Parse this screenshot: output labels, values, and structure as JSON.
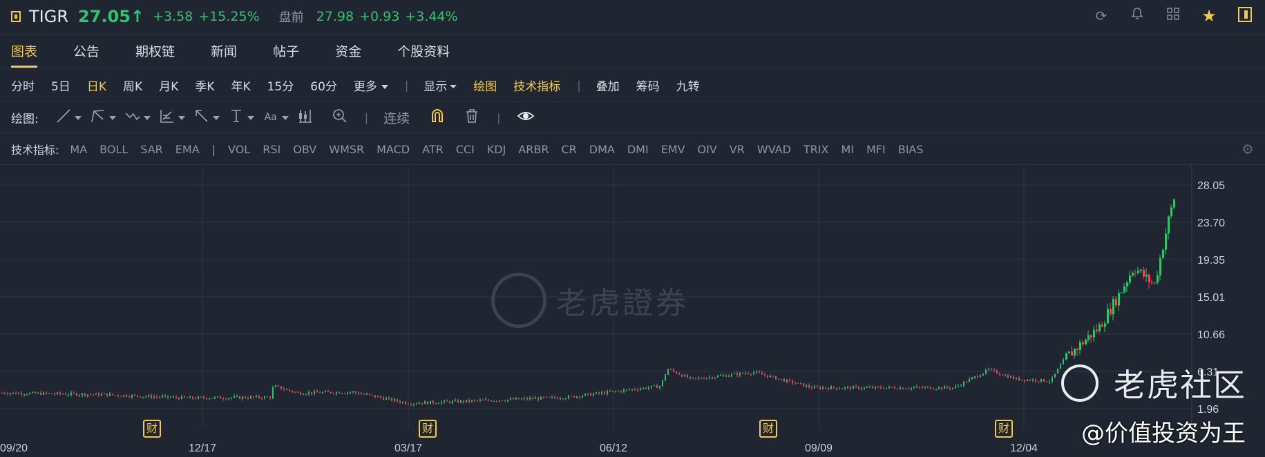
{
  "header": {
    "symbol": "TIGR",
    "price": "27.05↑",
    "change": "+3.58",
    "change_pct": "+15.25%",
    "premarket_label": "盘前",
    "premarket_price": "27.98",
    "premarket_change": "+0.93",
    "premarket_change_pct": "+3.44%"
  },
  "tabs": [
    "图表",
    "公告",
    "期权链",
    "新闻",
    "帖子",
    "资金",
    "个股资料"
  ],
  "periods": {
    "items": [
      "分时",
      "5日",
      "日K",
      "周K",
      "月K",
      "季K",
      "年K",
      "15分",
      "60分"
    ],
    "more": "更多",
    "display": "显示",
    "draw": "绘图",
    "indicators": "技术指标",
    "overlay": "叠加",
    "chips": "筹码",
    "nine": "九转"
  },
  "tools": {
    "label": "绘图:",
    "continuous": "连续"
  },
  "indicators": {
    "label": "技术指标:",
    "main": [
      "MA",
      "BOLL",
      "SAR",
      "EMA"
    ],
    "sub": [
      "VOL",
      "RSI",
      "OBV",
      "WMSR",
      "MACD",
      "ATR",
      "CCI",
      "KDJ",
      "ARBR",
      "CR",
      "DMA",
      "DMI",
      "EMV",
      "OIV",
      "VR",
      "WVAD",
      "TRIX",
      "MI",
      "MFI",
      "BIAS"
    ]
  },
  "chart": {
    "y_ticks": [
      "28.05",
      "23.70",
      "19.35",
      "15.01",
      "10.66",
      "6.31",
      "1.96"
    ],
    "x_ticks": [
      "09/20",
      "12/17",
      "03/17",
      "06/12",
      "09/09",
      "12/04"
    ],
    "earnings_badge": "财",
    "watermark": "老虎證券"
  },
  "overlay": {
    "community": "老虎社区",
    "credit": "@价值投资为王"
  },
  "colors": {
    "up": "#2fc56b",
    "down": "#f0455b",
    "accent": "#f2c94c",
    "bg": "#1f2631"
  }
}
